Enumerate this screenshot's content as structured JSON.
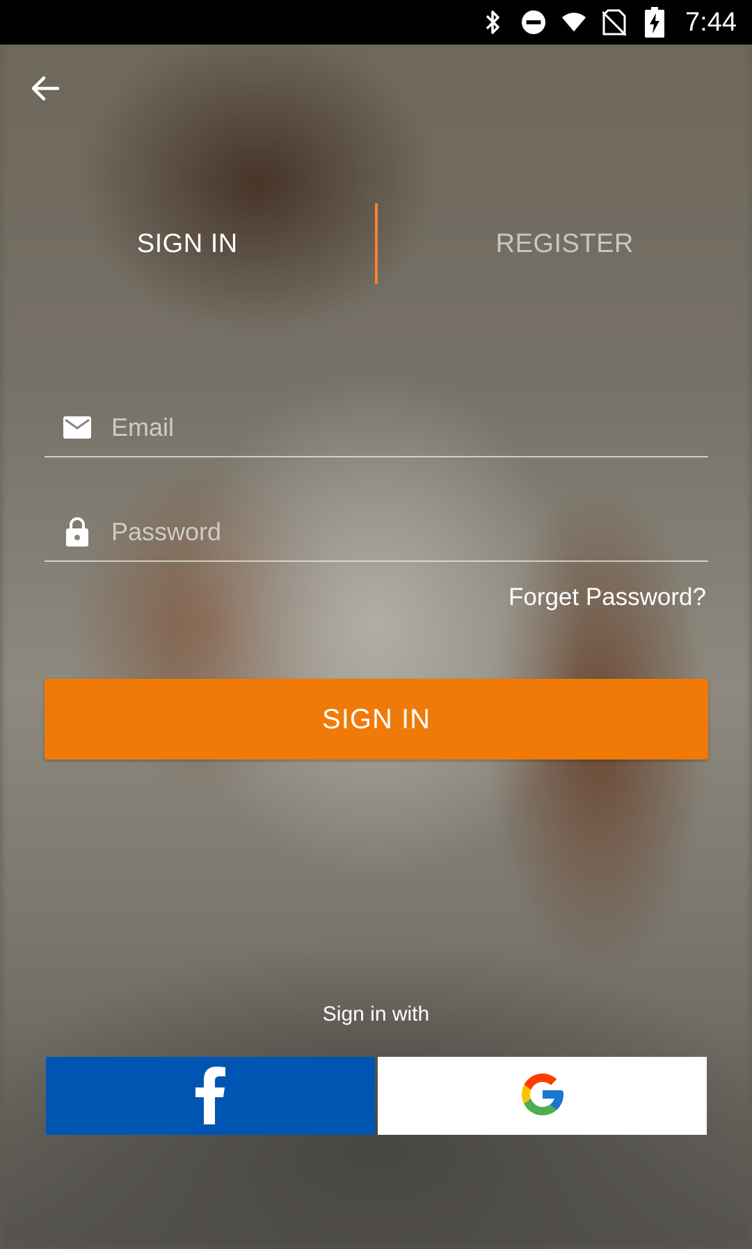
{
  "status_bar": {
    "time": "7:44",
    "icons": [
      "bluetooth-icon",
      "do-not-disturb-icon",
      "wifi-icon",
      "no-sim-icon",
      "battery-charging-icon"
    ]
  },
  "header": {
    "back_icon": "arrow-left-icon"
  },
  "tabs": [
    {
      "label": "SIGN IN",
      "active": true
    },
    {
      "label": "REGISTER",
      "active": false
    }
  ],
  "form": {
    "email": {
      "placeholder": "Email",
      "value": "",
      "icon": "mail-icon"
    },
    "password": {
      "placeholder": "Password",
      "value": "",
      "icon": "lock-icon"
    },
    "forgot_label": "Forget Password?",
    "submit_label": "SIGN IN"
  },
  "social": {
    "caption": "Sign in with",
    "facebook": {
      "icon": "facebook-icon",
      "color": "#0055b3"
    },
    "google": {
      "icon": "google-icon",
      "color": "#ffffff"
    }
  },
  "colors": {
    "accent": "#f07a07",
    "tab_divider": "#f4852f"
  }
}
